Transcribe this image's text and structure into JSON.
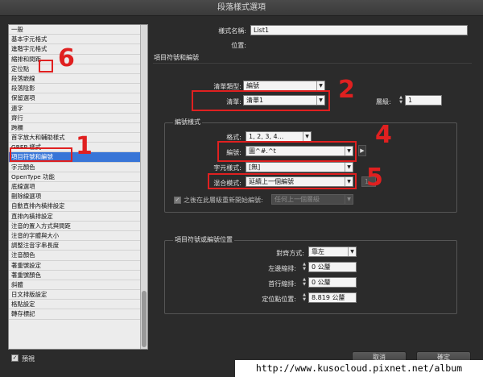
{
  "dialog": {
    "title": "段落樣式選項"
  },
  "categories": [
    "一般",
    "基本字元格式",
    "進階字元格式",
    "縮排和間距",
    "定位點",
    "段落嵌線",
    "段落陰影",
    "保留選項",
    "連字",
    "齊行",
    "跨欄",
    "首字放大和輔助樣式",
    "GREP 樣式",
    "項目符號和編號",
    "字元顏色",
    "OpenType 功能",
    "底線選項",
    "刪除線選項",
    "自動直排內橫排設定",
    "直排內橫排設定",
    "注音的置入方式與間距",
    "注音的字體與大小",
    "調整注音字串長度",
    "注音顏色",
    "著重號設定",
    "著重號顏色",
    "斜體",
    "日文排版設定",
    "格點設定",
    "轉存標記"
  ],
  "selected_category": "項目符號和編號",
  "style_name": {
    "label": "樣式名稱:",
    "value": "List1"
  },
  "location": {
    "label": "位置:"
  },
  "section_title": "項目符號和編號",
  "list_type": {
    "label": "清單類型:",
    "value": "編號"
  },
  "list": {
    "label": "清單:",
    "value": "清單1"
  },
  "level": {
    "label": "層級:",
    "value": "1"
  },
  "numbering_group": {
    "title": "編號樣式",
    "format": {
      "label": "格式:",
      "value": "1, 2, 3, 4..."
    },
    "number": {
      "label": "編號:",
      "value": "圖^#.^t"
    },
    "char_style": {
      "label": "字元樣式:",
      "value": "[無]"
    },
    "mode": {
      "label": "混合模式:",
      "value": "延續上一個編號",
      "side_value": "1"
    },
    "restart": {
      "label": "之後在此層級重新開始編號:",
      "value": "任何上一個層級",
      "checked": true
    }
  },
  "position_group": {
    "title": "項目符號或編號位置",
    "alignment": {
      "label": "對齊方式:",
      "value": "靠左"
    },
    "left_indent": {
      "label": "左邊縮排:",
      "value": "0 公釐"
    },
    "first_indent": {
      "label": "首行縮排:",
      "value": "0 公釐"
    },
    "tab_position": {
      "label": "定位點位置:",
      "value": "8.819 公釐"
    }
  },
  "annotations": [
    "1",
    "2",
    "4",
    "5",
    "6"
  ],
  "preview": {
    "label": "預視",
    "checked": true
  },
  "buttons": {
    "cancel": "取消",
    "ok": "確定"
  },
  "watermark": "http://www.kusocloud.pixnet.net/album",
  "colors": {
    "annotation_red": "#e02020",
    "selection_blue": "#3875d7",
    "dialog_bg": "#2b2b2b"
  }
}
